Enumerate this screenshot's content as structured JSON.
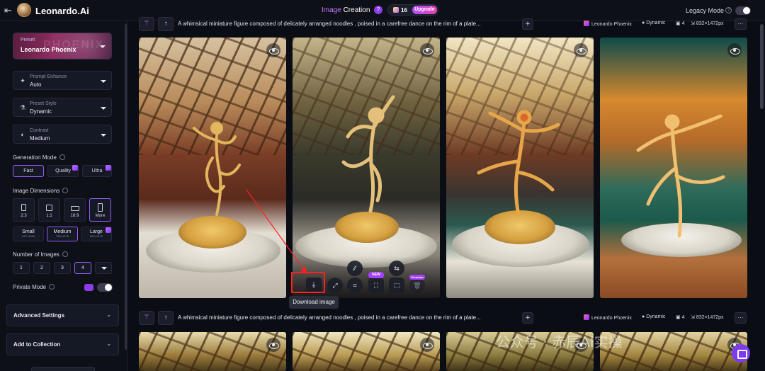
{
  "header": {
    "brand": "Leonardo.Ai",
    "title_part1": "Image",
    "title_part2": "Creation",
    "help_label": "?",
    "token_count": "16",
    "upgrade_label": "Upgrade",
    "legacy_mode_label": "Legacy Mode",
    "legacy_info": "?"
  },
  "sidebar": {
    "preset": {
      "label": "Preset",
      "value": "Leonardo Phoenix",
      "watermark": "PHOENIX"
    },
    "prompt_enhance": {
      "label": "Prompt Enhance",
      "value": "Auto"
    },
    "preset_style": {
      "label": "Preset Style",
      "value": "Dynamic"
    },
    "contrast": {
      "label": "Contrast",
      "value": "Medium"
    },
    "generation_mode": {
      "label": "Generation Mode",
      "options": [
        "Fast",
        "Quality",
        "Ultra"
      ],
      "selected": "Fast"
    },
    "image_dimensions": {
      "label": "Image Dimensions",
      "ratios": [
        "2:3",
        "1:1",
        "16:9",
        "More"
      ],
      "selected_ratio": "More",
      "sizes": [
        {
          "name": "Small",
          "dims": "672×1184"
        },
        {
          "name": "Medium",
          "dims": "768×1376"
        },
        {
          "name": "Large",
          "dims": "832×1472"
        }
      ],
      "selected_size": "Medium"
    },
    "number_of_images": {
      "label": "Number of Images",
      "options": [
        "1",
        "2",
        "3",
        "4"
      ],
      "selected": "4"
    },
    "private_mode": {
      "label": "Private Mode"
    },
    "advanced_settings": "Advanced Settings",
    "add_to_collection": "Add to Collection"
  },
  "generations": [
    {
      "prompt": "A whimsical miniature figure composed of delicately arranged noodles , poised in a carefree dance on the rim of a plate...",
      "model": "Leonardo Phoenix",
      "style": "Dynamic",
      "count": "4",
      "dimensions": "832×1472px",
      "more": "···"
    },
    {
      "prompt": "A whimsical miniature figure composed of delicately arranged noodles , poised in a carefree dance on the rim of a plate...",
      "model": "Leonardo Phoenix",
      "style": "Dynamic",
      "count": "4",
      "dimensions": "832×1472px",
      "more": "···"
    }
  ],
  "image_actions": {
    "new_badge": "NEW",
    "premium_badge": "Premium",
    "download_tooltip": "Download image"
  },
  "overlay_watermark": "公众号 · 赤辰AI实操",
  "colors": {
    "accent": "#9b5cff",
    "upgrade_gradient_start": "#b24dff",
    "upgrade_gradient_end": "#e342b0",
    "annotation_red": "#ff2020"
  }
}
